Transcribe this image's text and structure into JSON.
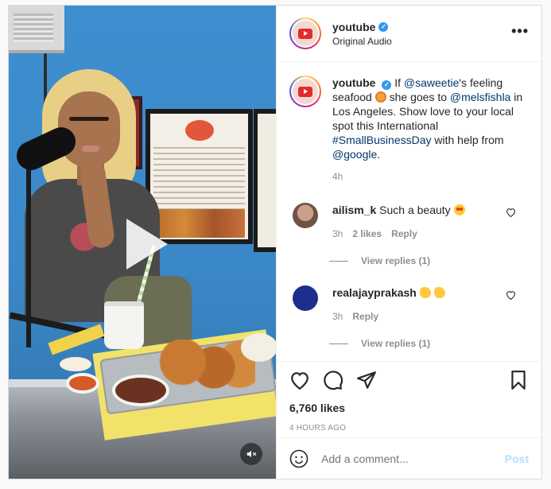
{
  "post": {
    "author": "youtube",
    "audio": "Original Audio",
    "more_icon": "more-options-icon"
  },
  "caption": {
    "username": "youtube",
    "text_1": "If",
    "mention_1": "@saweetie",
    "text_2": "'s feeling seafood",
    "text_3": "she goes to",
    "mention_2": "@melsfishla",
    "text_4": "in Los Angeles. Show love to your local spot this International",
    "hashtag": "#SmallBusinessDay",
    "text_5": "with help from",
    "mention_3": "@google",
    "text_6": ".",
    "time": "4h"
  },
  "comments": [
    {
      "username": "ailism_k",
      "text": "Such a beauty",
      "time": "3h",
      "likes": "2 likes",
      "reply": "Reply",
      "view_replies": "View replies (1)"
    },
    {
      "username": "realajayprakash",
      "text": "",
      "time": "3h",
      "reply": "Reply",
      "view_replies": "View replies (1)"
    }
  ],
  "actions": {
    "likes": "6,760 likes",
    "date": "4 HOURS AGO"
  },
  "composer": {
    "placeholder": "Add a comment...",
    "post_label": "Post"
  },
  "colors": {
    "link": "#00376b",
    "verified": "#3897f0",
    "post_button_disabled": "#b2dffc"
  }
}
